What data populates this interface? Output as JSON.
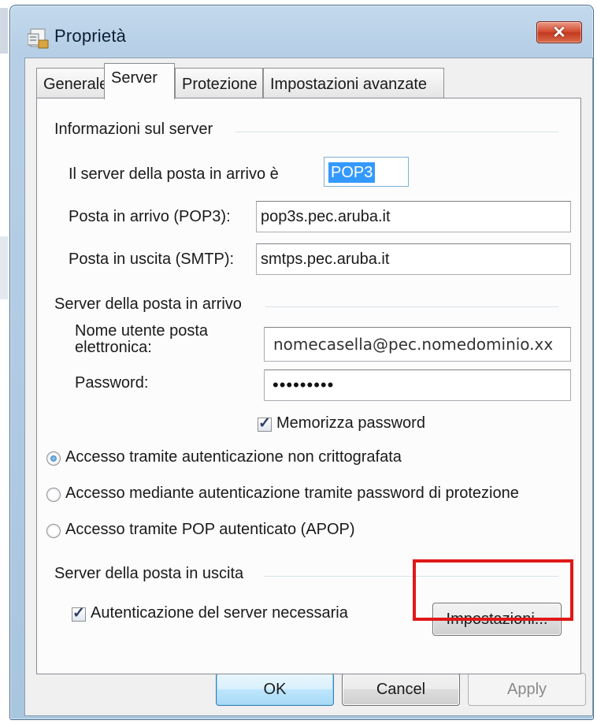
{
  "dialog": {
    "title": "Proprietà",
    "close_icon": "close-x-icon",
    "app_icon": "properties-icon"
  },
  "tabs": [
    {
      "label": "Generale",
      "active": false
    },
    {
      "label": "Server",
      "active": true
    },
    {
      "label": "Protezione",
      "active": false
    },
    {
      "label": "Impostazioni avanzate",
      "active": false
    }
  ],
  "server_info": {
    "group_label": "Informazioni sul server",
    "incoming_type_label": "Il server della posta in arrivo è",
    "incoming_type_value": "POP3",
    "incoming_label": "Posta in arrivo (POP3):",
    "incoming_value": "pop3s.pec.aruba.it",
    "outgoing_label": "Posta in uscita (SMTP):",
    "outgoing_value": "smtps.pec.aruba.it"
  },
  "incoming_server": {
    "group_label": "Server della posta in arrivo",
    "username_label_line1": "Nome utente posta",
    "username_label_line2": "elettronica:",
    "username_value": "nomecasella@pec.nomedominio.xx",
    "password_label": "Password:",
    "password_value": "•••••••••",
    "remember_label": "Memorizza password",
    "remember_checked": true
  },
  "auth_options": [
    {
      "label": "Accesso tramite autenticazione non crittografata",
      "selected": true
    },
    {
      "label": "Accesso mediante autenticazione tramite password di protezione",
      "selected": false
    },
    {
      "label": "Accesso tramite POP autenticato (APOP)",
      "selected": false
    }
  ],
  "outgoing_server": {
    "group_label": "Server della posta in uscita",
    "auth_required_label": "Autenticazione del server necessaria",
    "auth_required_checked": true,
    "settings_button": "Impostazioni..."
  },
  "buttons": {
    "ok": "OK",
    "cancel": "Cancel",
    "apply": "Apply"
  },
  "colors": {
    "highlight_box": "#e01818",
    "selection": "#3399ff"
  }
}
